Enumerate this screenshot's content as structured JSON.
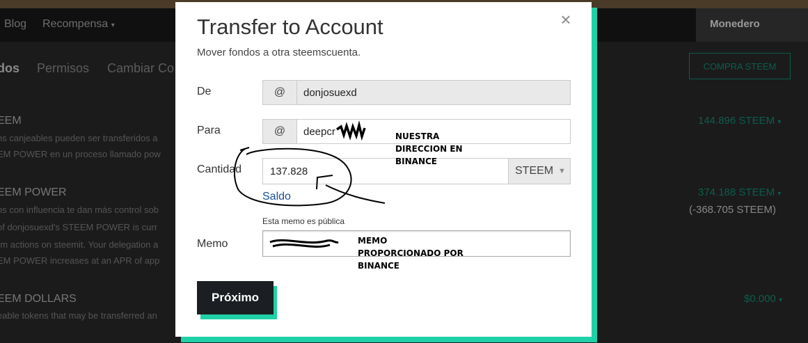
{
  "background": {
    "nav": {
      "items": [
        "Blog",
        "Recompensa"
      ],
      "wallet_label": "Monedero"
    },
    "tabs": [
      "dos",
      "Permisos",
      "Cambiar Co"
    ],
    "buy_button": "COMPRA STEEM",
    "sections": [
      {
        "heading": "EEM",
        "lines": [
          "ns canjeables pueden ser transferidos a",
          "EM POWER en un proceso llamado pow"
        ],
        "value": "144.896 STEEM"
      },
      {
        "heading": "EEM POWER",
        "lines": [
          "ns con influencia te dan más control sob",
          "of donjosuexd's STEEM POWER is curr",
          "rm actions on steemit. Your delegation a",
          "EM POWER increases at an APR of app"
        ],
        "value": "374.188 STEEM",
        "delegated": "(-368.705 STEEM)"
      },
      {
        "heading": "EEM DOLLARS",
        "lines": [
          "eable tokens that may be transferred an"
        ],
        "value": "$0.000"
      }
    ]
  },
  "modal": {
    "title": "Transfer to Account",
    "subtitle": "Mover fondos a otra steemscuenta.",
    "close_glyph": "×",
    "from": {
      "label": "De",
      "prefix": "@",
      "value": "donjosuexd"
    },
    "to": {
      "label": "Para",
      "prefix": "@",
      "value": "deepcr"
    },
    "amount": {
      "label": "Cantidad",
      "value": "137.828",
      "currency": "STEEM",
      "chevron": "▼"
    },
    "balance_link": "Saldo",
    "memo": {
      "label": "Memo",
      "note": "Esta memo es pública",
      "value": ""
    },
    "submit_label": "Próximo"
  },
  "annotations": {
    "address_note": [
      "NUESTRA",
      "DIRECCION EN",
      "BINANCE"
    ],
    "memo_note": [
      "MEMO",
      "PROPORCIONADO POR",
      "BINANCE"
    ]
  },
  "colors": {
    "accent": "#1fd1a7",
    "button_bg": "#1b1f23",
    "link": "#1a5099",
    "backdrop": "#1b1b1b"
  }
}
